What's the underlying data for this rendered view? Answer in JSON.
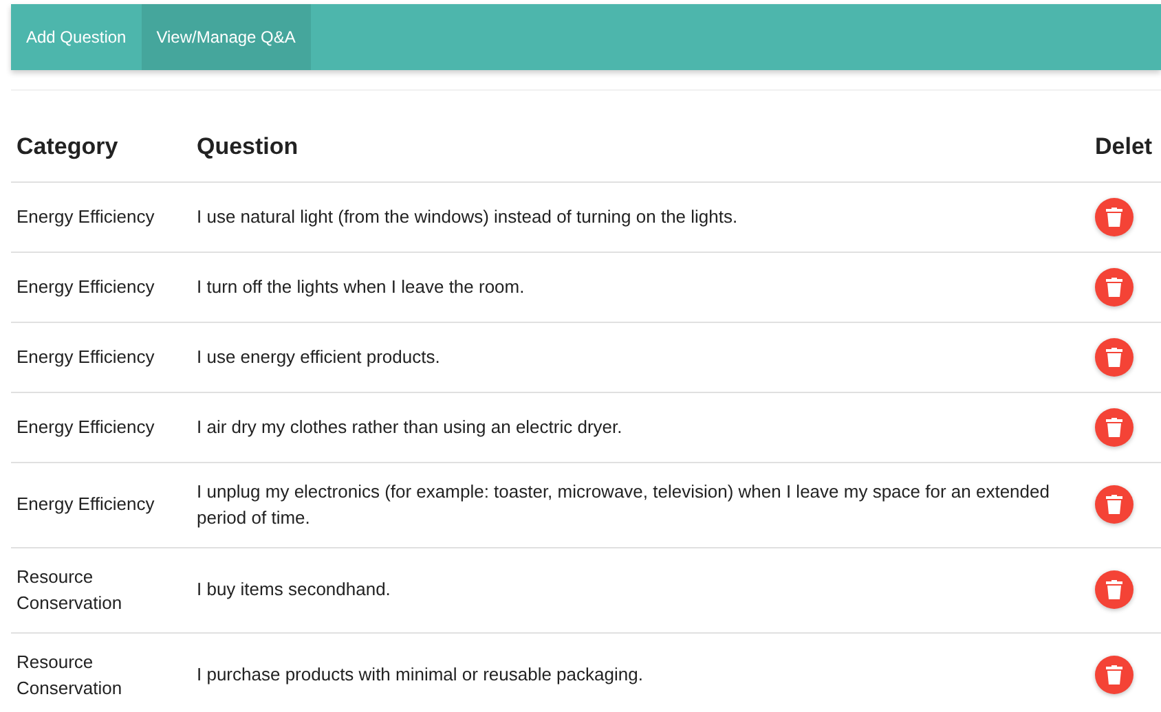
{
  "tabs": [
    {
      "label": "Add Question",
      "selected": false
    },
    {
      "label": "View/Manage Q&A",
      "selected": true
    }
  ],
  "table": {
    "columns": [
      "Category",
      "Question",
      "Delet"
    ],
    "rows": [
      {
        "category": "Energy Efficiency",
        "question": "I use natural light (from the windows) instead of turning on the lights."
      },
      {
        "category": "Energy Efficiency",
        "question": "I turn off the lights when I leave the room."
      },
      {
        "category": "Energy Efficiency",
        "question": "I use energy efficient products."
      },
      {
        "category": "Energy Efficiency",
        "question": "I air dry my clothes rather than using an electric dryer."
      },
      {
        "category": "Energy Efficiency",
        "question": "I unplug my electronics (for example: toaster, microwave, television) when I leave my space for an extended period of time."
      },
      {
        "category": "Resource Conservation",
        "question": "I buy items secondhand."
      },
      {
        "category": "Resource Conservation",
        "question": "I purchase products with minimal or reusable packaging."
      }
    ]
  }
}
